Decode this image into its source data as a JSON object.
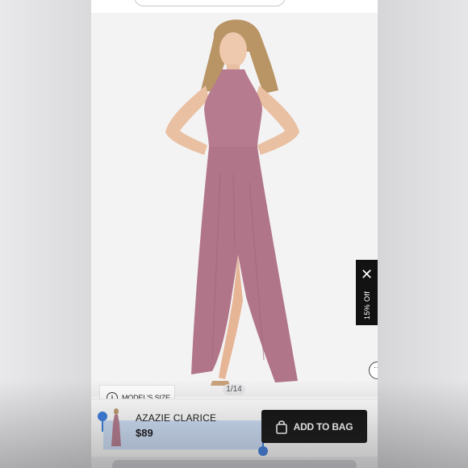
{
  "product": {
    "name": "AZAZIE CLARICE",
    "price": "$89"
  },
  "gallery": {
    "counter": "1/14",
    "models_size_label": "MODEL'S SIZE"
  },
  "promo": {
    "close_glyph": "✕",
    "label": "15% Off"
  },
  "actions": {
    "add_to_bag_label": "ADD TO BAG",
    "more_glyph": "···"
  },
  "info_glyph": "i",
  "colors": {
    "dress": "#b77b8f",
    "cta_background": "#111111",
    "selection_highlight": "#aac8f5",
    "selection_handle": "#3a7de0"
  },
  "icons": [
    "info-icon",
    "close-icon",
    "bag-icon",
    "more-icon"
  ]
}
